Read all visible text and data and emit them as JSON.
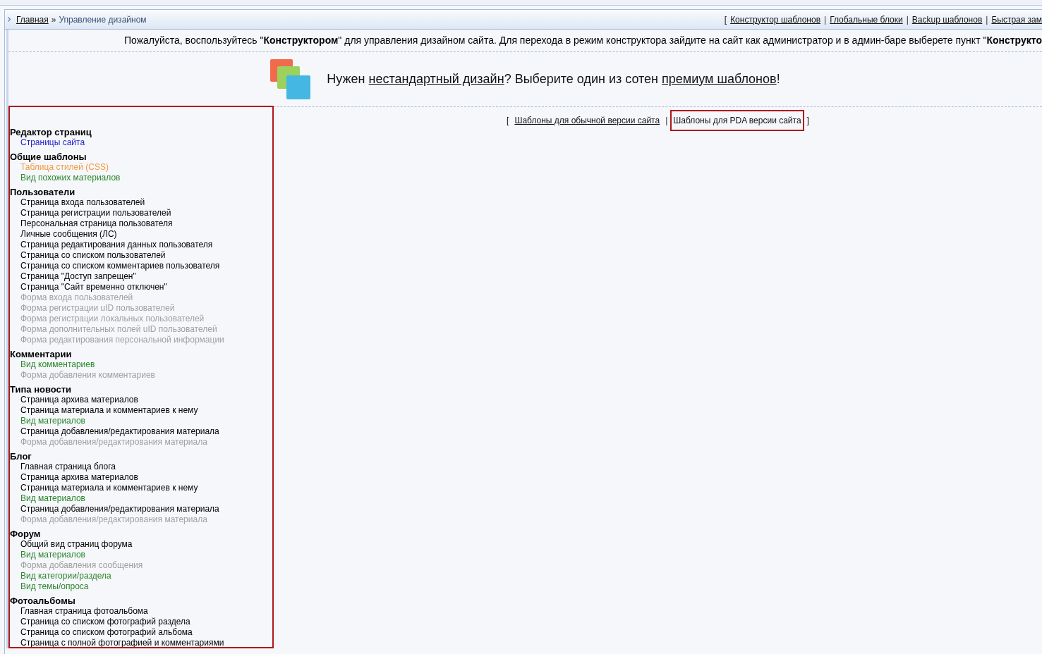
{
  "breadcrumb": {
    "home": "Главная",
    "separator": "»",
    "current": "Управление дизайном"
  },
  "top_links": {
    "open": "[",
    "items": [
      "Конструктор шаблонов",
      "Глобальные блоки",
      "Backup шаблонов",
      "Быстрая зам"
    ],
    "separator": "|"
  },
  "notice": "Пожалуйста, воспользуйтесь \"**Конструктором**\" для управления дизайном сайта. Для перехода в режим конструктора зайдите на сайт как администратор и в админ-баре выберете пункт \"**Конструкто**",
  "banner": {
    "parts": [
      {
        "kind": "text",
        "text": "Нужен "
      },
      {
        "kind": "link",
        "text": "нестандартный дизайн"
      },
      {
        "kind": "text",
        "text": "? Выберите один из сотен "
      },
      {
        "kind": "link",
        "text": "премиум шаблонов"
      },
      {
        "kind": "text",
        "text": "!"
      }
    ]
  },
  "version_tabs": {
    "open": "[",
    "close": "]",
    "separator": "|",
    "items": [
      {
        "label": "Шаблоны для обычной версии сайта",
        "selected": false,
        "highlighted": false
      },
      {
        "label": "Шаблоны для PDA версии сайта",
        "selected": true,
        "highlighted": true
      }
    ]
  },
  "sidebar": {
    "highlighted": true,
    "groups": [
      {
        "title": "Редактор страниц",
        "items": [
          {
            "label": "Страницы сайта",
            "color": "#1c1cc8"
          }
        ]
      },
      {
        "title": "Общие шаблоны",
        "items": [
          {
            "label": "Таблица стилей (CSS)",
            "color": "#f39a3e"
          },
          {
            "label": "Вид похожих материалов",
            "color": "#2c862c"
          }
        ]
      },
      {
        "title": "Пользователи",
        "items": [
          {
            "label": "Страница входа пользователей",
            "color": "#000000"
          },
          {
            "label": "Страница регистрации пользователей",
            "color": "#000000"
          },
          {
            "label": "Персональная страница пользователя",
            "color": "#000000"
          },
          {
            "label": "Личные сообщения (ЛС)",
            "color": "#000000"
          },
          {
            "label": "Страница редактирования данных пользователя",
            "color": "#000000"
          },
          {
            "label": "Страница со списком пользователей",
            "color": "#000000"
          },
          {
            "label": "Страница со списком комментариев пользователя",
            "color": "#000000"
          },
          {
            "label": "Страница \"Доступ запрещен\"",
            "color": "#000000"
          },
          {
            "label": "Страница \"Сайт временно отключен\"",
            "color": "#000000"
          },
          {
            "label": "Форма входа пользователей",
            "color": "#a0a0a0"
          },
          {
            "label": "Форма регистрации uID пользователей",
            "color": "#a0a0a0"
          },
          {
            "label": "Форма регистрации локальных пользователей",
            "color": "#a0a0a0"
          },
          {
            "label": "Форма дополнительных полей uID пользователей",
            "color": "#a0a0a0"
          },
          {
            "label": "Форма редактирования персональной информации",
            "color": "#a0a0a0"
          }
        ]
      },
      {
        "title": "Комментарии",
        "items": [
          {
            "label": "Вид комментариев",
            "color": "#2c862c"
          },
          {
            "label": "Форма добавления комментариев",
            "color": "#a0a0a0"
          }
        ]
      },
      {
        "title": "Типа новости",
        "items": [
          {
            "label": "Страница архива материалов",
            "color": "#000000"
          },
          {
            "label": "Страница материала и комментариев к нему",
            "color": "#000000"
          },
          {
            "label": "Вид материалов",
            "color": "#2c862c"
          },
          {
            "label": "Страница добавления/редактирования материала",
            "color": "#000000"
          },
          {
            "label": "Форма добавления/редактирования материала",
            "color": "#a0a0a0"
          }
        ]
      },
      {
        "title": "Блог",
        "items": [
          {
            "label": "Главная страница блога",
            "color": "#000000"
          },
          {
            "label": "Страница архива материалов",
            "color": "#000000"
          },
          {
            "label": "Страница материала и комментариев к нему",
            "color": "#000000"
          },
          {
            "label": "Вид материалов",
            "color": "#2c862c"
          },
          {
            "label": "Страница добавления/редактирования материала",
            "color": "#000000"
          },
          {
            "label": "Форма добавления/редактирования материала",
            "color": "#a0a0a0"
          }
        ]
      },
      {
        "title": "Форум",
        "items": [
          {
            "label": "Общий вид страниц форума",
            "color": "#000000"
          },
          {
            "label": "Вид материалов",
            "color": "#2c862c"
          },
          {
            "label": "Форма добавления сообщения",
            "color": "#a0a0a0"
          },
          {
            "label": "Вид категории/раздела",
            "color": "#2c862c"
          },
          {
            "label": "Вид темы/опроса",
            "color": "#2c862c"
          }
        ]
      },
      {
        "title": "Фотоальбомы",
        "items": [
          {
            "label": "Главная страница фотоальбома",
            "color": "#000000"
          },
          {
            "label": "Страница со списком фотографий раздела",
            "color": "#000000"
          },
          {
            "label": "Страница со списком фотографий альбома",
            "color": "#000000"
          },
          {
            "label": "Страница с полной фотографией и комментариями",
            "color": "#000000"
          }
        ]
      }
    ]
  }
}
